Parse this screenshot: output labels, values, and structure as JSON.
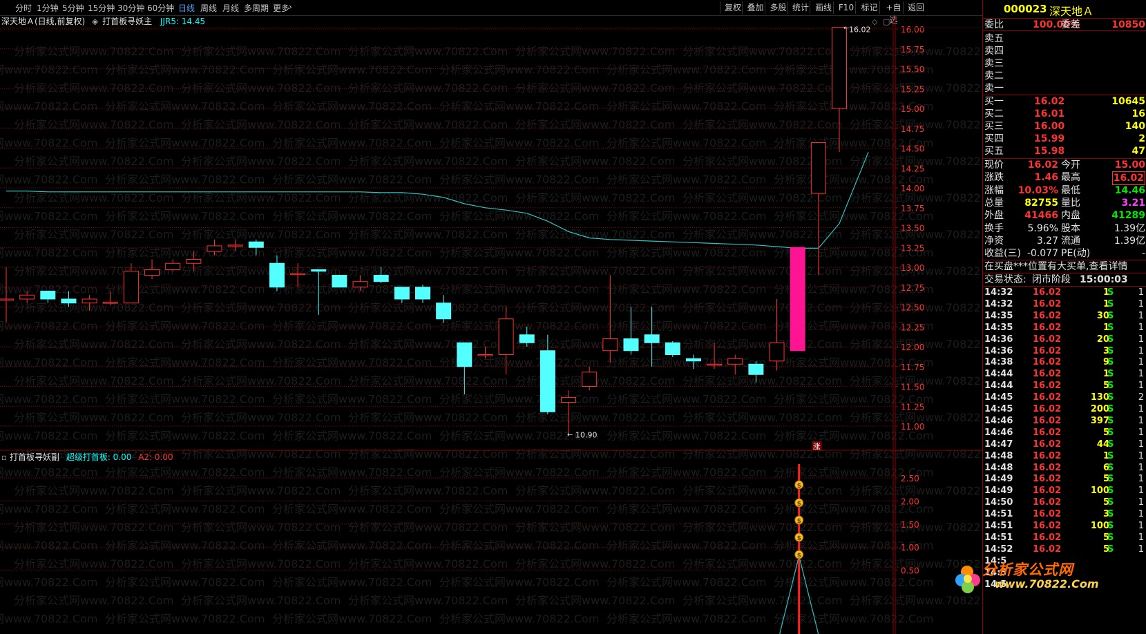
{
  "toolbar": {
    "periods": [
      "分时",
      "1分钟",
      "5分钟",
      "15分钟",
      "30分钟",
      "60分钟",
      "日线",
      "周线",
      "月线",
      "多周期",
      "更多"
    ],
    "active_period": "日线",
    "right_buttons": [
      "复权",
      "叠加",
      "多股",
      "统计",
      "画线",
      "F10",
      "标记",
      "+自选",
      "返回"
    ]
  },
  "chart_header": {
    "stock_label": "深天地Ａ(日线,前复权)",
    "indicator_name": "打首板寻妖主",
    "indicator_value": "JJR5: 14.45"
  },
  "sub_header": {
    "name": "打首板寻妖副",
    "value1": "超级打首板: 0.00",
    "value2": "A2: 0.00"
  },
  "watermark": "分析家公式网www.70822.Com",
  "zhang_label": "涨",
  "chart_data": {
    "type": "candlestick",
    "y_axis_main": [
      "16.00",
      "15.75",
      "15.50",
      "15.25",
      "15.00",
      "14.75",
      "14.50",
      "14.25",
      "14.00",
      "13.75",
      "13.50",
      "13.25",
      "13.00",
      "12.75",
      "12.50",
      "12.25",
      "12.00",
      "11.75",
      "11.50",
      "11.25",
      "11.00"
    ],
    "y_axis_sub": [
      "2.50",
      "2.00",
      "1.50",
      "1.00",
      "0.50"
    ],
    "max_label": "16.02",
    "min_label": "10.90",
    "candles": [
      {
        "o": 12.6,
        "c": 12.6,
        "h": 13.0,
        "l": 12.3
      },
      {
        "o": 12.6,
        "c": 12.65,
        "h": 12.7,
        "l": 12.55
      },
      {
        "o": 12.7,
        "c": 12.6,
        "h": 12.7,
        "l": 12.55
      },
      {
        "o": 12.6,
        "c": 12.55,
        "h": 12.7,
        "l": 12.5
      },
      {
        "o": 12.55,
        "c": 12.6,
        "h": 12.65,
        "l": 12.45
      },
      {
        "o": 12.55,
        "c": 12.56,
        "h": 12.7,
        "l": 12.52
      },
      {
        "o": 12.55,
        "c": 12.95,
        "h": 13.05,
        "l": 12.55
      },
      {
        "o": 12.9,
        "c": 12.97,
        "h": 13.1,
        "l": 12.85
      },
      {
        "o": 12.97,
        "c": 13.05,
        "h": 13.1,
        "l": 12.95
      },
      {
        "o": 13.05,
        "c": 13.1,
        "h": 13.2,
        "l": 12.95
      },
      {
        "o": 13.2,
        "c": 13.27,
        "h": 13.35,
        "l": 13.15
      },
      {
        "o": 13.28,
        "c": 13.28,
        "h": 13.35,
        "l": 13.2
      },
      {
        "o": 13.32,
        "c": 13.25,
        "h": 13.35,
        "l": 13.15
      },
      {
        "o": 13.05,
        "c": 12.75,
        "h": 13.15,
        "l": 12.7
      },
      {
        "o": 12.92,
        "c": 12.92,
        "h": 13.05,
        "l": 12.75
      },
      {
        "o": 12.97,
        "c": 12.95,
        "h": 12.97,
        "l": 12.4
      },
      {
        "o": 12.9,
        "c": 12.75,
        "h": 12.9,
        "l": 12.75
      },
      {
        "o": 12.75,
        "c": 12.82,
        "h": 12.9,
        "l": 12.7
      },
      {
        "o": 12.9,
        "c": 12.82,
        "h": 13.0,
        "l": 12.8
      },
      {
        "o": 12.75,
        "c": 12.6,
        "h": 12.75,
        "l": 12.55
      },
      {
        "o": 12.75,
        "c": 12.6,
        "h": 12.78,
        "l": 12.55
      },
      {
        "o": 12.55,
        "c": 12.35,
        "h": 12.65,
        "l": 12.3
      },
      {
        "o": 12.05,
        "c": 11.75,
        "h": 12.05,
        "l": 11.4
      },
      {
        "o": 11.9,
        "c": 11.9,
        "h": 12.0,
        "l": 11.85
      },
      {
        "o": 11.9,
        "c": 12.35,
        "h": 12.5,
        "l": 11.65
      },
      {
        "o": 12.15,
        "c": 12.05,
        "h": 12.25,
        "l": 12.0
      },
      {
        "o": 11.95,
        "c": 11.18,
        "h": 12.15,
        "l": 11.15
      },
      {
        "o": 11.3,
        "c": 11.36,
        "h": 11.45,
        "l": 10.9
      },
      {
        "o": 11.5,
        "c": 11.68,
        "h": 11.75,
        "l": 11.45
      },
      {
        "o": 11.95,
        "c": 12.1,
        "h": 12.9,
        "l": 11.8
      },
      {
        "o": 12.1,
        "c": 11.95,
        "h": 12.5,
        "l": 11.9
      },
      {
        "o": 12.15,
        "c": 12.05,
        "h": 12.5,
        "l": 11.75
      },
      {
        "o": 12.05,
        "c": 11.9,
        "h": 12.07,
        "l": 11.87
      },
      {
        "o": 11.85,
        "c": 11.82,
        "h": 11.9,
        "l": 11.72
      },
      {
        "o": 11.78,
        "c": 11.78,
        "h": 12.05,
        "l": 11.72
      },
      {
        "o": 11.78,
        "c": 11.85,
        "h": 11.9,
        "l": 11.65
      },
      {
        "o": 11.78,
        "c": 11.65,
        "h": 11.82,
        "l": 11.55
      },
      {
        "o": 11.82,
        "c": 12.05,
        "h": 12.6,
        "l": 11.7
      },
      {
        "o": 13.25,
        "c": 11.95,
        "h": 13.25,
        "l": 11.95
      },
      {
        "o": 13.93,
        "c": 14.57,
        "h": 14.57,
        "l": 12.9
      },
      {
        "o": 15.0,
        "c": 16.02,
        "h": 16.02,
        "l": 14.45
      }
    ],
    "ma_line": [
      13.96,
      13.96,
      13.95,
      13.95,
      13.95,
      13.95,
      13.95,
      13.95,
      13.95,
      13.95,
      13.95,
      13.95,
      13.95,
      13.95,
      13.95,
      13.95,
      13.95,
      13.95,
      13.94,
      13.94,
      13.92,
      13.88,
      13.8,
      13.75,
      13.72,
      13.68,
      13.58,
      13.45,
      13.37,
      13.35,
      13.34,
      13.33,
      13.32,
      13.31,
      13.3,
      13.29,
      13.28,
      13.26,
      13.24,
      13.24,
      13.55,
      14.45
    ]
  },
  "panel": {
    "code": "000023",
    "name": "深天地Ａ",
    "weibi_label": "委比",
    "weibi_value": "100.00%",
    "weicha_label": "委差",
    "weicha_value": "10850",
    "sell_labels": [
      "卖五",
      "卖四",
      "卖三",
      "卖二",
      "卖一"
    ],
    "buy_rows": [
      {
        "label": "买一",
        "price": "16.02",
        "vol": "10645"
      },
      {
        "label": "买二",
        "price": "16.01",
        "vol": "16"
      },
      {
        "label": "买三",
        "price": "16.00",
        "vol": "140"
      },
      {
        "label": "买四",
        "price": "15.99",
        "vol": "2"
      },
      {
        "label": "买五",
        "price": "15.98",
        "vol": "47"
      }
    ],
    "stats": [
      {
        "l1": "现价",
        "v1": "16.02",
        "l2": "今开",
        "v2": "15.00"
      },
      {
        "l1": "涨跌",
        "v1": "1.46",
        "l2": "最高",
        "v2": "16.02"
      },
      {
        "l1": "涨幅",
        "v1": "10.03%",
        "l2": "最低",
        "v2": "14.46"
      },
      {
        "l1": "总量",
        "v1": "82755",
        "l2": "量比",
        "v2": "3.21"
      },
      {
        "l1": "外盘",
        "v1": "41466",
        "l2": "内盘",
        "v2": "41289"
      },
      {
        "l1": "换手",
        "v1": "5.96%",
        "l2": "股本",
        "v2": "1.39亿"
      },
      {
        "l1": "净资",
        "v1": "3.27",
        "l2": "流通",
        "v2": "1.39亿"
      },
      {
        "l1": "收益(三)",
        "v1": "-0.077",
        "l2": "PE(动)",
        "v2": "-"
      }
    ],
    "notice": "在买盘***位置有大买单,查看详情",
    "trade_status_label": "交易状态:",
    "trade_status_value": "闭市阶段",
    "trade_time": "15:00:03",
    "ticks": [
      {
        "t": "14:32",
        "p": "16.02",
        "v": "1",
        "s": "S",
        "n": "1"
      },
      {
        "t": "14:32",
        "p": "16.02",
        "v": "1",
        "s": "S",
        "n": "1"
      },
      {
        "t": "14:35",
        "p": "16.02",
        "v": "30",
        "s": "S",
        "n": "1"
      },
      {
        "t": "14:35",
        "p": "16.02",
        "v": "1",
        "s": "S",
        "n": "1"
      },
      {
        "t": "14:36",
        "p": "16.02",
        "v": "20",
        "s": "S",
        "n": "1"
      },
      {
        "t": "14:36",
        "p": "16.02",
        "v": "3",
        "s": "S",
        "n": "1"
      },
      {
        "t": "14:38",
        "p": "16.02",
        "v": "9",
        "s": "S",
        "n": "1"
      },
      {
        "t": "14:44",
        "p": "16.02",
        "v": "1",
        "s": "S",
        "n": "1"
      },
      {
        "t": "14:44",
        "p": "16.02",
        "v": "5",
        "s": "S",
        "n": "1"
      },
      {
        "t": "14:45",
        "p": "16.02",
        "v": "130",
        "s": "S",
        "n": "2"
      },
      {
        "t": "14:45",
        "p": "16.02",
        "v": "200",
        "s": "S",
        "n": "1"
      },
      {
        "t": "14:46",
        "p": "16.02",
        "v": "397",
        "s": "S",
        "n": "1"
      },
      {
        "t": "14:46",
        "p": "16.02",
        "v": "5",
        "s": "S",
        "n": "1"
      },
      {
        "t": "14:47",
        "p": "16.02",
        "v": "44",
        "s": "S",
        "n": "1"
      },
      {
        "t": "14:48",
        "p": "16.02",
        "v": "1",
        "s": "S",
        "n": "1"
      },
      {
        "t": "14:48",
        "p": "16.02",
        "v": "6",
        "s": "S",
        "n": "1"
      },
      {
        "t": "14:49",
        "p": "16.02",
        "v": "5",
        "s": "S",
        "n": "1"
      },
      {
        "t": "14:49",
        "p": "16.02",
        "v": "100",
        "s": "S",
        "n": "1"
      },
      {
        "t": "14:50",
        "p": "16.02",
        "v": "5",
        "s": "S",
        "n": "1"
      },
      {
        "t": "14:51",
        "p": "16.02",
        "v": "3",
        "s": "S",
        "n": "1"
      },
      {
        "t": "14:51",
        "p": "16.02",
        "v": "100",
        "s": "S",
        "n": "1"
      },
      {
        "t": "14:51",
        "p": "16.02",
        "v": "5",
        "s": "S",
        "n": "1"
      },
      {
        "t": "14:52",
        "p": "16.02",
        "v": "5",
        "s": "S",
        "n": "1"
      },
      {
        "t": "14:5",
        "p": "",
        "v": "",
        "s": "",
        "n": ""
      },
      {
        "t": "14:5",
        "p": "",
        "v": "",
        "s": "",
        "n": ""
      },
      {
        "t": "14:5",
        "p": "",
        "v": "",
        "s": "",
        "n": ""
      }
    ],
    "logo_text": "分析家公式网",
    "logo_url": "www.70822.Com"
  },
  "colors": {
    "up": "#ff3232",
    "down": "#54ffff",
    "ma": "#2ec4c4",
    "limit_up": "#ff1493",
    "grid": "#8b0000",
    "bg": "#000000"
  }
}
